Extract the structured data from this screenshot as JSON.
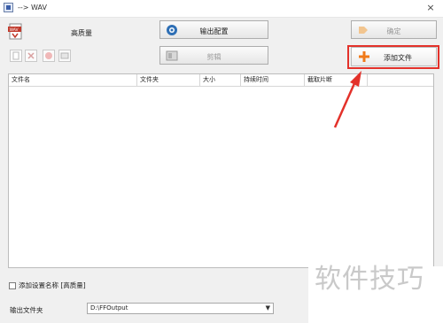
{
  "window": {
    "title": "--> WAV",
    "close_glyph": "×"
  },
  "quality": {
    "label": "高质量",
    "icon": "wav-file-icon"
  },
  "buttons": {
    "output_settings": "输出配置",
    "edit": "剪辑",
    "confirm": "确定",
    "add_file": "添加文件"
  },
  "table": {
    "columns": [
      "文件名",
      "文件夹",
      "大小",
      "持续时间",
      "截取片断",
      ""
    ]
  },
  "options": {
    "add_setting_name_label": "添加设置名称 [高质量]",
    "add_setting_name_checked": false
  },
  "output": {
    "label": "输出文件夹",
    "folder": "D:\\FFOutput"
  },
  "watermark": "软件技巧",
  "colors": {
    "highlight": "#e3312a",
    "add_icon": "#f07a1a"
  }
}
